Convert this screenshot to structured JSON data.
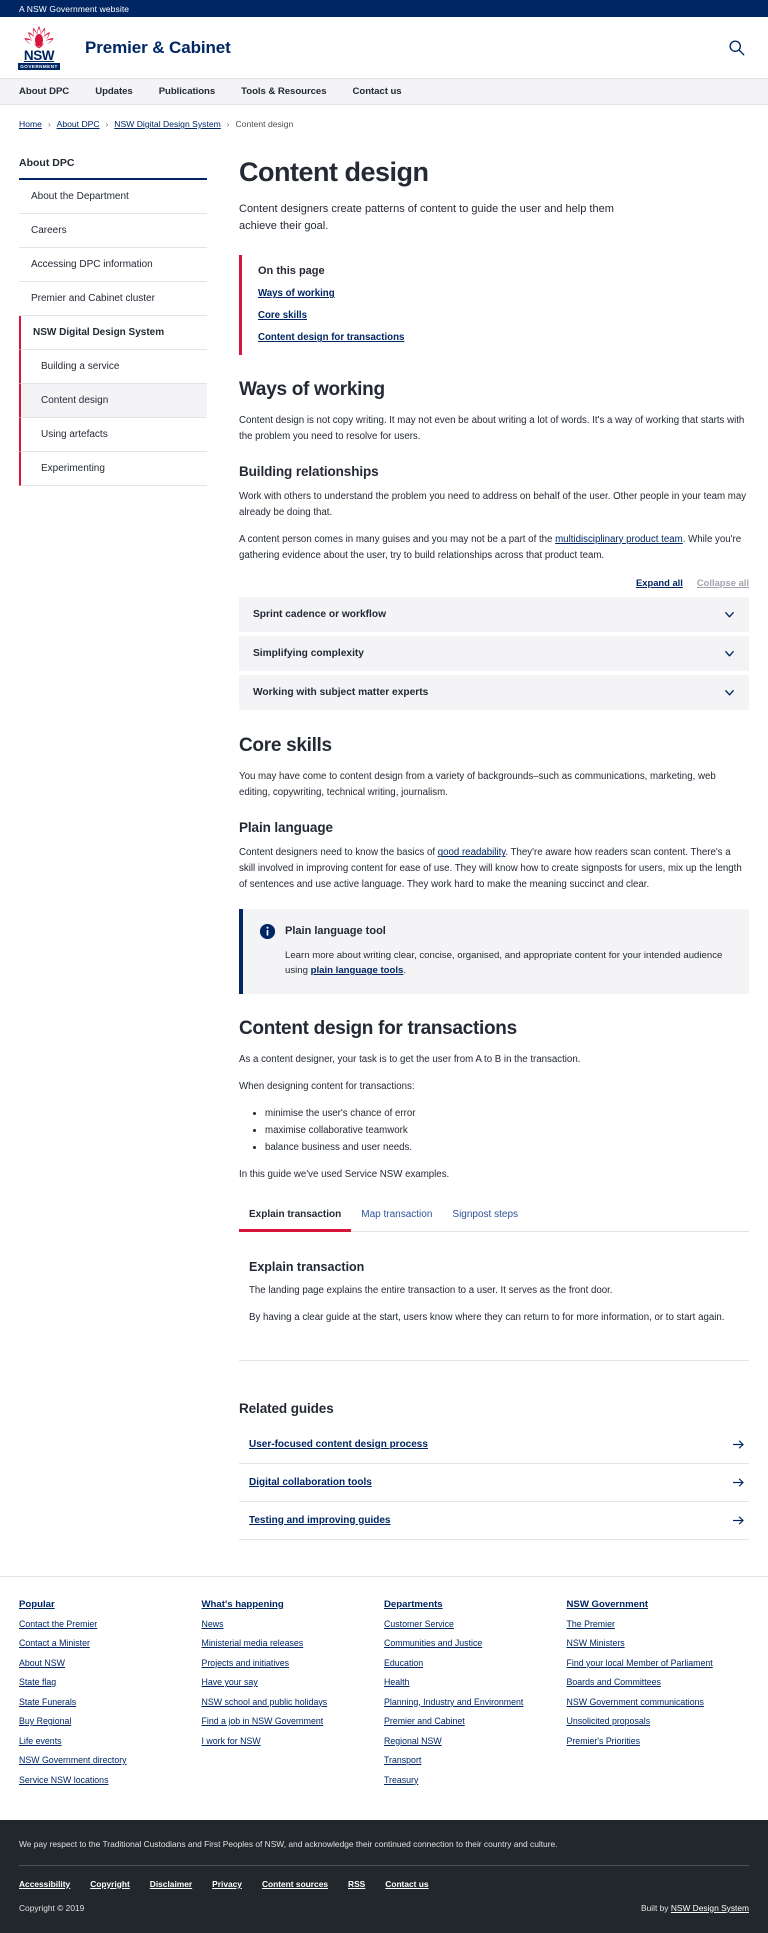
{
  "gov_bar": {
    "text": "A NSW Government website"
  },
  "masthead": {
    "site_title": "Premier & Cabinet",
    "logo_nsw": "NSW",
    "logo_gov": "GOVERNMENT",
    "search_icon": "search-icon"
  },
  "main_nav": {
    "items": [
      {
        "label": "About DPC"
      },
      {
        "label": "Updates"
      },
      {
        "label": "Publications"
      },
      {
        "label": "Tools & Resources"
      },
      {
        "label": "Contact us"
      }
    ]
  },
  "breadcrumb": {
    "items": [
      {
        "label": "Home",
        "link": true
      },
      {
        "label": "About DPC",
        "link": true
      },
      {
        "label": "NSW Digital Design System",
        "link": true
      },
      {
        "label": "Content design",
        "link": false
      }
    ],
    "separator": "›"
  },
  "sidebar": {
    "title": "About DPC",
    "items": [
      {
        "label": "About the Department",
        "type": "item"
      },
      {
        "label": "Careers",
        "type": "item"
      },
      {
        "label": "Accessing DPC information",
        "type": "item"
      },
      {
        "label": "Premier and Cabinet cluster",
        "type": "item"
      },
      {
        "label": "NSW Digital Design System",
        "type": "group"
      },
      {
        "label": "Building a service",
        "type": "child"
      },
      {
        "label": "Content design",
        "type": "child-active"
      },
      {
        "label": "Using artefacts",
        "type": "child"
      },
      {
        "label": "Experimenting",
        "type": "child"
      }
    ]
  },
  "main": {
    "page_title": "Content design",
    "intro": "Content designers create patterns of content to guide the user and help them achieve their goal.",
    "on_this_page": {
      "title": "On this page",
      "links": [
        "Ways of working",
        "Core skills",
        "Content design for transactions"
      ]
    },
    "ways_of_working": {
      "heading": "Ways of working",
      "paragraph": "Content design is not copy writing. It may not even be about writing a lot of words. It's a way of working that starts with the problem you need to resolve for users.",
      "building_relationships": {
        "heading": "Building relationships",
        "p1": "Work with others to understand the problem you need to address on behalf of the user. Other people in your team may already be doing that.",
        "p2_before": "A content person comes in many guises and you may not be a part of the ",
        "p2_link": "multidisciplinary product team",
        "p2_after": ". While you're gathering evidence about the user, try to build relationships across that product team."
      },
      "expand_all": "Expand all",
      "collapse_all": "Collapse all",
      "accordions": [
        {
          "label": "Sprint cadence or workflow"
        },
        {
          "label": "Simplifying complexity"
        },
        {
          "label": "Working with subject matter experts"
        }
      ]
    },
    "core_skills": {
      "heading": "Core skills",
      "paragraph": "You may have come to content design from a variety of backgrounds–such as communications, marketing, web editing, copywriting, technical writing, journalism.",
      "plain_language": {
        "heading": "Plain language",
        "p_before": "Content designers need to know the basics of ",
        "p_link": "good readability",
        "p_after": ". They're aware how readers scan content. There's a skill involved in improving content for ease of use. They will know how to create signposts for users, mix up the length of sentences and use active language. They work hard to make the meaning succinct and clear."
      },
      "callout": {
        "icon": "info-icon",
        "title": "Plain language tool",
        "body_before": "Learn more about writing clear, concise, organised, and appropriate content for your intended audience using ",
        "body_link": "plain language tools",
        "body_after": "."
      }
    },
    "transactions": {
      "heading": "Content design for transactions",
      "p1": "As a content designer, your task is to get the user from A to B in the transaction.",
      "p2": "When designing content for transactions:",
      "bullets": [
        "minimise the user's chance of error",
        "maximise collaborative teamwork",
        "balance business and user needs."
      ],
      "p3": "In this guide we've used Service NSW examples.",
      "tabs": [
        {
          "label": "Explain transaction",
          "active": true
        },
        {
          "label": "Map transaction",
          "active": false
        },
        {
          "label": "Signpost steps",
          "active": false
        }
      ],
      "panel": {
        "heading": "Explain transaction",
        "p1": "The landing page explains the entire transaction to a user. It serves as the front door.",
        "p2": "By having a clear guide at the start, users know where they can return to for more information, or to start again."
      }
    },
    "related_guides": {
      "heading": "Related guides",
      "items": [
        {
          "label": "User-focused content design process"
        },
        {
          "label": "Digital collaboration tools"
        },
        {
          "label": "Testing and improving guides"
        }
      ]
    }
  },
  "footer": {
    "columns": [
      {
        "title": "Popular",
        "links": [
          "Contact the Premier",
          "Contact a Minister",
          "About NSW",
          "State flag",
          "State Funerals",
          "Buy Regional",
          "Life events",
          "NSW Government directory",
          "Service NSW locations"
        ]
      },
      {
        "title": "What's happening",
        "links": [
          "News",
          "Ministerial media releases",
          "Projects and initiatives",
          "Have your say",
          "NSW school and public holidays",
          "Find a job in NSW Government",
          "I work for NSW"
        ]
      },
      {
        "title": "Departments",
        "links": [
          "Customer Service",
          "Communities and Justice",
          "Education",
          "Health",
          "Planning, Industry and Environment",
          "Premier and Cabinet",
          "Regional NSW",
          "Transport",
          "Treasury"
        ]
      },
      {
        "title": "NSW Government",
        "links": [
          "The Premier",
          "NSW Ministers",
          "Find your local Member of Parliament",
          "Boards and Committees",
          "NSW Government communications",
          "Unsolicited proposals",
          "Premier's Priorities"
        ]
      }
    ],
    "acknowledgement": "We pay respect to the Traditional Custodians and First Peoples of NSW, and acknowledge their continued connection to their country and culture.",
    "legal_links": [
      "Accessibility",
      "Copyright",
      "Disclaimer",
      "Privacy",
      "Content sources",
      "RSS",
      "Contact us"
    ],
    "copyright": "Copyright © 2019",
    "built_by_prefix": "Built by ",
    "built_by_link": "NSW Design System"
  },
  "colors": {
    "brand_navy": "#002664",
    "brand_red": "#d7153a",
    "text": "#242934",
    "grey_bg": "#f4f4f7",
    "footer_dark": "#22272b"
  }
}
